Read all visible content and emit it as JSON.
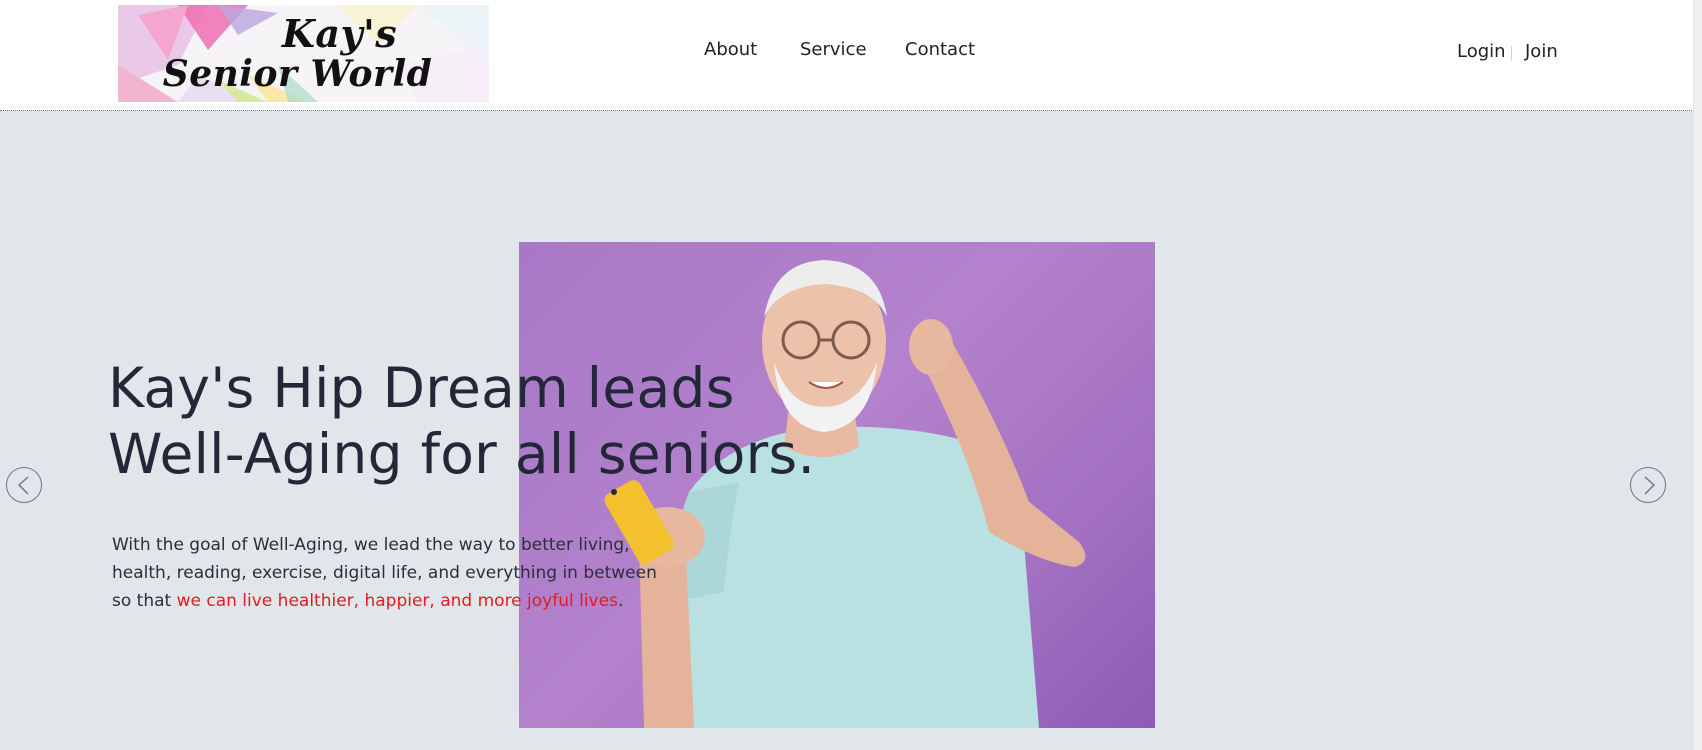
{
  "header": {
    "logo": {
      "line1": "Kay's",
      "line2": "Senior World"
    },
    "nav": [
      {
        "label": "About"
      },
      {
        "label": "Service"
      },
      {
        "label": "Contact"
      }
    ],
    "auth": {
      "login_label": "Login",
      "join_label": "Join"
    }
  },
  "hero": {
    "headline": {
      "line1": "Kay's Hip Dream leads",
      "line2": "Well-Aging for all seniors."
    },
    "subtext": {
      "line1": "With the goal of Well-Aging, we lead the way to better living,",
      "line2": "health, reading, exercise, digital life, and everything in between",
      "line3_prefix": "so that ",
      "line3_highlight": "we can live healthier, happier, and more joyful lives",
      "line3_suffix": "."
    },
    "photo_icon": "senior-with-phone-photo",
    "prev_icon": "chevron-left-icon",
    "next_icon": "chevron-right-icon"
  },
  "colors": {
    "hero_background": "#e0e6e9",
    "headline": "#232838",
    "accent": "#e01c24",
    "photo_background": "#a878c8"
  }
}
